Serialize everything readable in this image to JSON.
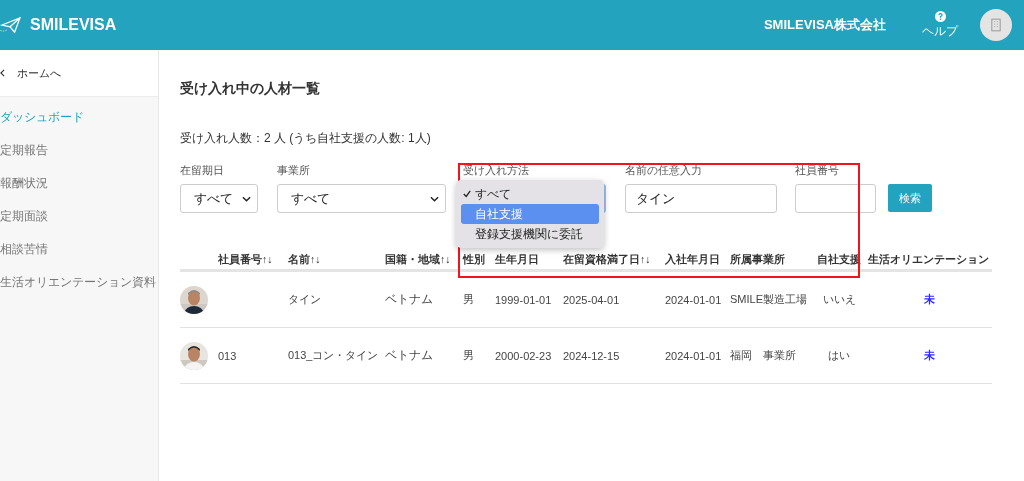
{
  "header": {
    "brand": "SMILEVISA",
    "company": "SMILEVISA株式会社",
    "help_label": "ヘルプ"
  },
  "sidebar": {
    "back_link": "ホームへ",
    "items": [
      {
        "label": "ダッシュボード",
        "selected": true
      },
      {
        "label": "定期報告",
        "selected": false
      },
      {
        "label": "報酬状況",
        "selected": false
      },
      {
        "label": "定期面談",
        "selected": false
      },
      {
        "label": "相談苦情",
        "selected": false
      },
      {
        "label": "生活オリエンテーション資料",
        "selected": false
      }
    ]
  },
  "page": {
    "title": "受け入れ中の人材一覧",
    "count_text": "受け入れ人数：2 人 (うち自社支援の人数: 1人)"
  },
  "filters": [
    {
      "kind": "select",
      "label": "在留期日",
      "value": "すべて"
    },
    {
      "kind": "select",
      "label": "事業所",
      "value": "すべて"
    },
    {
      "kind": "open-select",
      "label": "受け入れ方法",
      "options": [
        {
          "label": "すべて",
          "checked": true,
          "selected": false
        },
        {
          "label": "自社支援",
          "checked": false,
          "selected": true
        },
        {
          "label": "登録支援機関に委託",
          "checked": false,
          "selected": false
        }
      ]
    },
    {
      "kind": "text",
      "label": "名前の任意入力",
      "value": "タイン"
    },
    {
      "kind": "text",
      "label": "社員番号"
    }
  ],
  "search_button": "検索",
  "table": {
    "columns": [
      {
        "label": "社員番号↑↓"
      },
      {
        "label": "名前↑↓"
      },
      {
        "label": "国籍・地域↑↓"
      },
      {
        "label": "性別"
      },
      {
        "label": "生年月日"
      },
      {
        "label": "在留資格満了日↑↓"
      },
      {
        "label": "入社年月日"
      },
      {
        "label": "所属事業所"
      },
      {
        "label": "自社支援"
      },
      {
        "label": "生活オリエンテーション"
      }
    ],
    "rows": [
      {
        "cells": [
          "",
          "タイン",
          "ベトナム",
          "男",
          "1999-01-01",
          "2025-04-01",
          "2024-01-01",
          "SMILE製造工場",
          "いいえ",
          "未"
        ]
      },
      {
        "cells": [
          "013",
          "013_コン・タイン",
          "ベトナム",
          "男",
          "2000-02-23",
          "2024-12-15",
          "2024-01-01",
          "福岡　事業所",
          "はい",
          "未"
        ]
      }
    ]
  }
}
